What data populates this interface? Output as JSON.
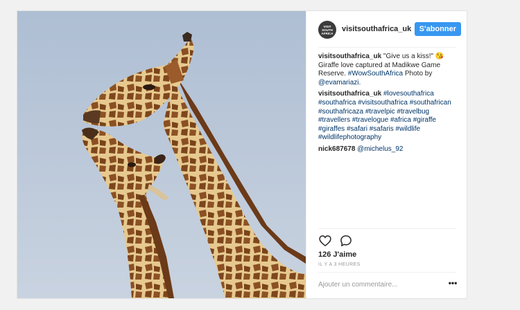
{
  "post": {
    "username": "visitsouthafrica_uk",
    "avatar_text": "VISIT SOUTH AFRICA",
    "follow_label": "S'abonner",
    "caption": {
      "author": "visitsouthafrica_uk",
      "text_1": " \"Give us a kiss!\" 😘 Giraffe love captured at Madikwe Game Reserve. ",
      "hashtag": "#WowSouthAfrica",
      "text_2": " Photo by ",
      "mention": "@evamariazi",
      "text_3": "."
    },
    "comments": [
      {
        "author": "visitsouthafrica_uk",
        "text": "#lovesouthafrica #southafrica #visitsouthafrica #southafrican #southafricaza #travelpic #travelbug #travellers #travelogue #africa #giraffe #giraffes #safari #safaris #wildlife #wildlifephotography"
      },
      {
        "author": "nick687678",
        "text": "@michelus_92"
      }
    ],
    "likes": "126 J'aime",
    "timestamp": "IL Y A 3 HEURES",
    "add_comment_placeholder": "Ajouter un commentaire...",
    "more_label": "•••"
  },
  "icons": {
    "like": "heart-icon",
    "comment": "comment-icon"
  },
  "colors": {
    "follow_button": "#3897f0",
    "link": "#003569",
    "sky": "#b9c7d8"
  }
}
